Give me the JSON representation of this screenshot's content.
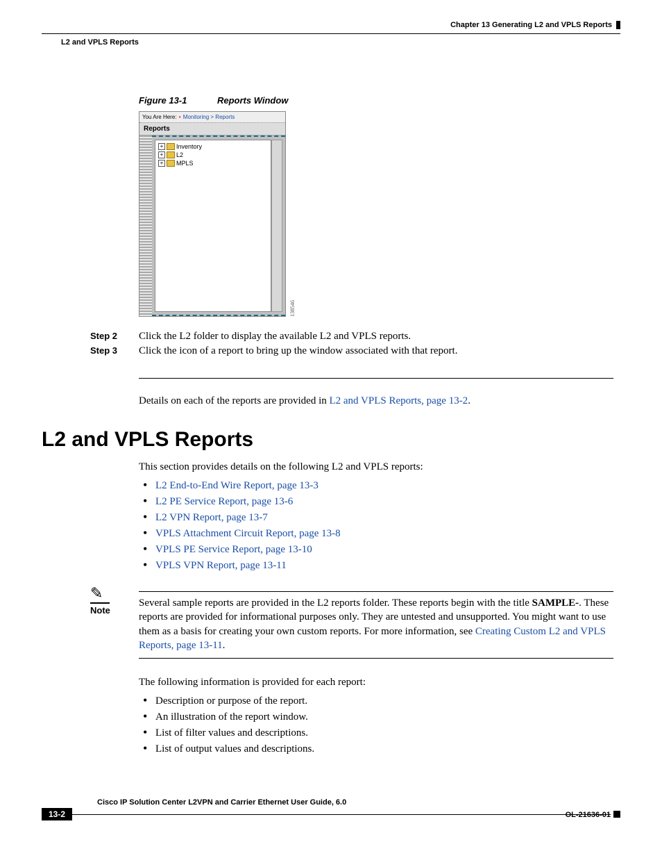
{
  "header": {
    "chapter": "Chapter 13    Generating L2 and VPLS Reports",
    "section": "L2 and VPLS Reports"
  },
  "figure": {
    "number": "Figure 13-1",
    "title": "Reports Window",
    "breadcrumb": {
      "prefix": "You Are Here:",
      "path1": "Monitoring",
      "path2": "Reports"
    },
    "panel_title": "Reports",
    "tree": {
      "item1": "Inventory",
      "item2": "L2",
      "item3": "MPLS"
    },
    "sidecode": "138546"
  },
  "steps": {
    "s2": {
      "label": "Step 2",
      "text": "Click the L2 folder to display the available L2 and VPLS reports."
    },
    "s3": {
      "label": "Step 3",
      "text": "Click the icon of a report to bring up the window associated with that report."
    }
  },
  "details_para_prefix": "Details on each of the reports are provided in ",
  "details_link": "L2 and VPLS Reports, page 13-2",
  "details_para_suffix": ".",
  "heading": "L2 and VPLS Reports",
  "intro": "This section provides details on the following L2 and VPLS reports:",
  "report_links": {
    "r1": "L2 End-to-End Wire Report, page 13-3",
    "r2": "L2 PE Service Report, page 13-6",
    "r3": "L2 VPN Report, page 13-7",
    "r4": "VPLS Attachment Circuit Report, page 13-8",
    "r5": "VPLS PE Service Report, page 13-10",
    "r6": "VPLS VPN Report, page 13-11"
  },
  "note": {
    "label": "Note",
    "pre": "Several sample reports are provided in the L2 reports folder. These reports begin with the title ",
    "bold": "SAMPLE-",
    "mid": ". These reports are provided for informational purposes only. They are untested and unsupported. You might want to use them as a basis for creating your own custom reports. For more information, see ",
    "link": "Creating Custom L2 and VPLS Reports, page 13-11",
    "post": "."
  },
  "info_para": "The following information is provided for each report:",
  "info_list": {
    "i1": "Description or purpose of the report.",
    "i2": "An illustration of the report window.",
    "i3": "List of filter values and descriptions.",
    "i4": "List of output values and descriptions."
  },
  "footer": {
    "book": "Cisco IP Solution Center L2VPN and Carrier Ethernet User Guide, 6.0",
    "page": "13-2",
    "doc": "OL-21636-01"
  }
}
